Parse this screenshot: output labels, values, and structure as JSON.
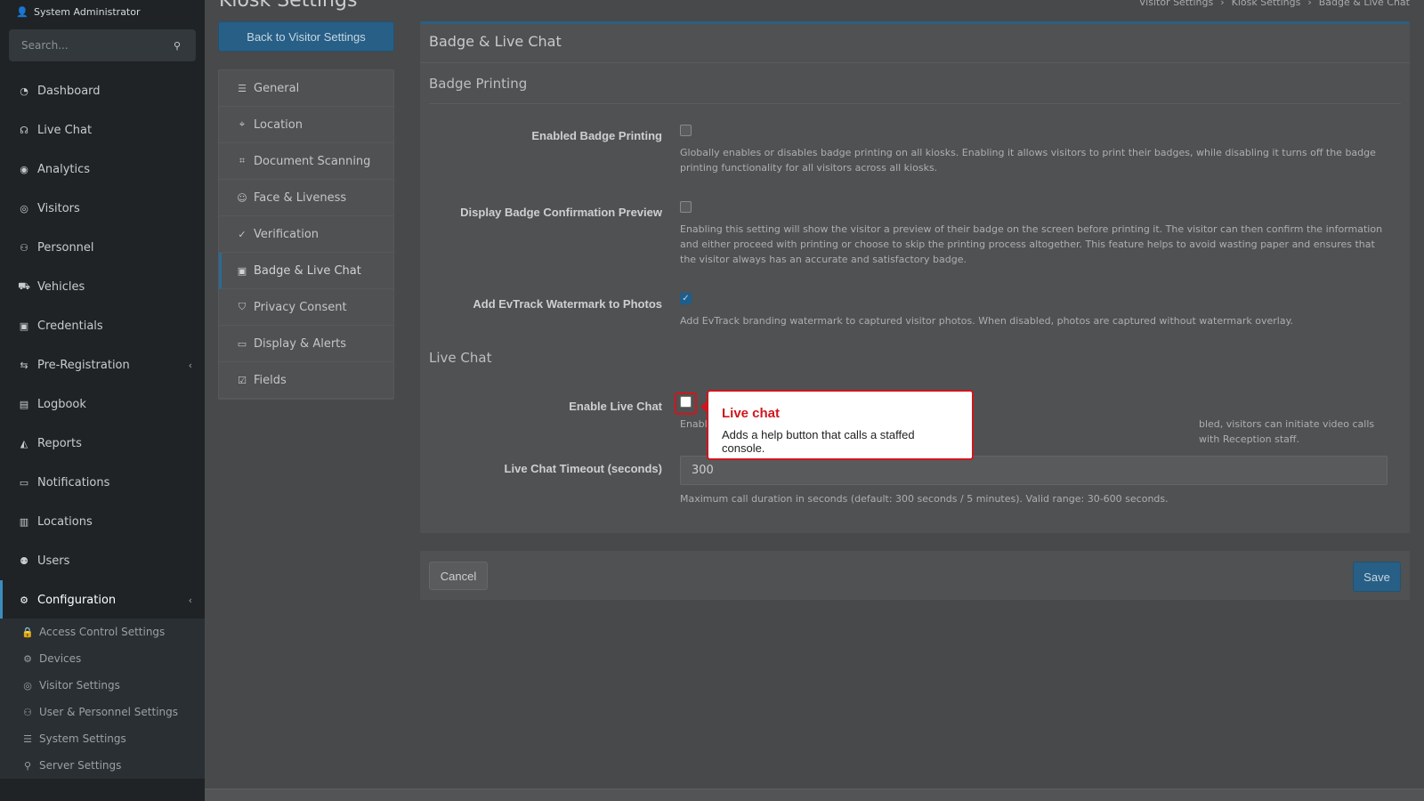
{
  "user": {
    "name": "System Administrator"
  },
  "search": {
    "placeholder": "Search..."
  },
  "sidebar": {
    "items": [
      {
        "label": "Dashboard",
        "icon": "dashboard-icon"
      },
      {
        "label": "Live Chat",
        "icon": "headset-icon"
      },
      {
        "label": "Analytics",
        "icon": "analytics-icon"
      },
      {
        "label": "Visitors",
        "icon": "eye-icon"
      },
      {
        "label": "Personnel",
        "icon": "personnel-icon"
      },
      {
        "label": "Vehicles",
        "icon": "vehicle-icon"
      },
      {
        "label": "Credentials",
        "icon": "credentials-icon"
      },
      {
        "label": "Pre-Registration",
        "icon": "pre-registration-icon"
      },
      {
        "label": "Logbook",
        "icon": "logbook-icon"
      },
      {
        "label": "Reports",
        "icon": "reports-icon"
      },
      {
        "label": "Notifications",
        "icon": "notifications-icon"
      },
      {
        "label": "Locations",
        "icon": "locations-icon"
      },
      {
        "label": "Users",
        "icon": "users-icon"
      },
      {
        "label": "Configuration",
        "icon": "gear-icon"
      }
    ],
    "sub_items": [
      {
        "label": "Access Control Settings",
        "icon": "lock-icon"
      },
      {
        "label": "Devices",
        "icon": "devices-icon"
      },
      {
        "label": "Visitor Settings",
        "icon": "eye-icon"
      },
      {
        "label": "User & Personnel Settings",
        "icon": "user-settings-icon"
      },
      {
        "label": "System Settings",
        "icon": "sliders-icon"
      },
      {
        "label": "Server Settings",
        "icon": "server-icon"
      }
    ]
  },
  "page": {
    "title": "Kiosk Settings"
  },
  "breadcrumbs": [
    "Visitor Settings",
    "Kiosk Settings",
    "Badge & Live Chat"
  ],
  "back_button": "Back to Visitor Settings",
  "settings_nav": [
    {
      "label": "General",
      "icon": "sliders-icon"
    },
    {
      "label": "Location",
      "icon": "map-pin-icon"
    },
    {
      "label": "Document Scanning",
      "icon": "scan-icon"
    },
    {
      "label": "Face & Liveness",
      "icon": "face-icon"
    },
    {
      "label": "Verification",
      "icon": "shield-check-icon"
    },
    {
      "label": "Badge & Live Chat",
      "icon": "badge-icon"
    },
    {
      "label": "Privacy Consent",
      "icon": "shield-icon"
    },
    {
      "label": "Display & Alerts",
      "icon": "display-icon"
    },
    {
      "label": "Fields",
      "icon": "list-check-icon"
    }
  ],
  "card": {
    "title": "Badge & Live Chat",
    "badge_section": "Badge Printing",
    "live_chat_section": "Live Chat",
    "fields": {
      "badge_printing": {
        "label": "Enabled Badge Printing",
        "help": "Globally enables or disables badge printing on all kiosks. Enabling it allows visitors to print their badges, while disabling it turns off the badge printing functionality for all visitors across all kiosks.",
        "checked": false
      },
      "badge_preview": {
        "label": "Display Badge Confirmation Preview",
        "help": "Enabling this setting will show the visitor a preview of their badge on the screen before printing it. The visitor can then confirm the information and either proceed with printing or choose to skip the printing process altogether. This feature helps to avoid wasting paper and ensures that the visitor always has an accurate and satisfactory badge.",
        "checked": false
      },
      "watermark": {
        "label": "Add EvTrack Watermark to Photos",
        "help": "Add EvTrack branding watermark to captured visitor photos. When disabled, photos are captured without watermark overlay.",
        "checked": true
      },
      "live_chat": {
        "label": "Enable Live Chat",
        "help_left": "Enabl",
        "help_right": "bled, visitors can initiate video calls with Reception staff.",
        "checked": false
      },
      "timeout": {
        "label": "Live Chat Timeout (seconds)",
        "value": "300",
        "help": "Maximum call duration in seconds (default: 300 seconds / 5 minutes). Valid range: 30-600 seconds."
      }
    }
  },
  "footer": {
    "cancel": "Cancel",
    "save": "Save"
  },
  "tooltip": {
    "title": "Live chat",
    "text": "Adds a help button that calls a staffed console."
  },
  "colors": {
    "accent": "#275f86",
    "highlight": "#d0161d"
  }
}
